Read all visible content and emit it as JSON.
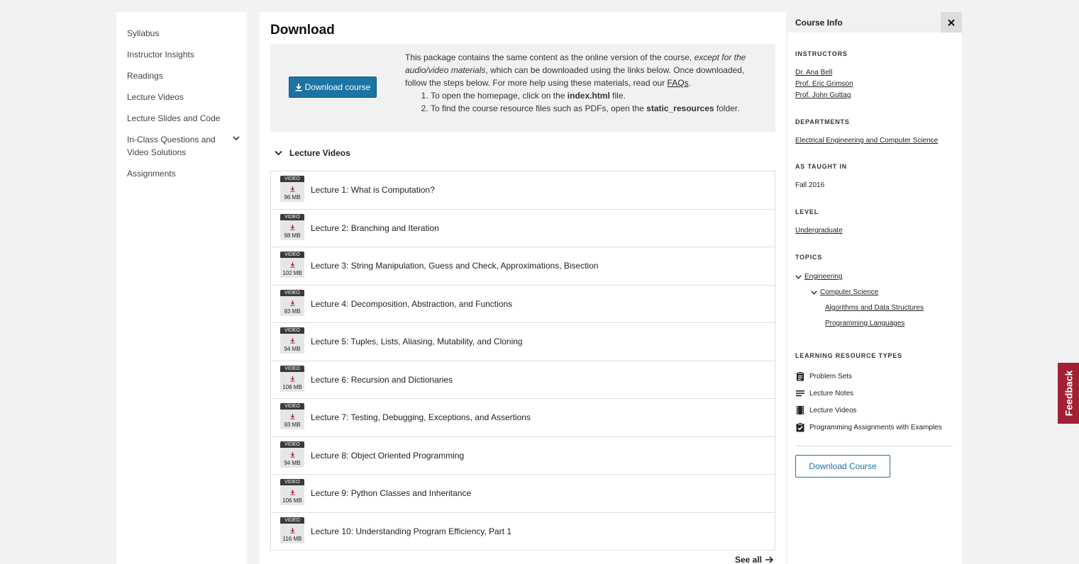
{
  "sidebar": {
    "items": [
      {
        "label": "Syllabus"
      },
      {
        "label": "Instructor Insights"
      },
      {
        "label": "Readings"
      },
      {
        "label": "Lecture Videos"
      },
      {
        "label": "Lecture Slides and Code"
      },
      {
        "label": "In-Class Questions and Video Solutions",
        "expandable": true
      },
      {
        "label": "Assignments"
      }
    ]
  },
  "main": {
    "title": "Download",
    "download_box": {
      "button_label": "Download course",
      "text_intro": "This package contains the same content as the online version of the course, ",
      "text_italic": "except for the audio/video materials",
      "text_middle": ", which can be downloaded using the links below. Once downloaded, follow the steps below. For more help using these materials, read our ",
      "faq_link": "FAQs",
      "text_end": ".",
      "step1_pre": "To open the homepage, click on the ",
      "step1_bold": "index.html",
      "step1_post": " file.",
      "step2_pre": "To find the course resource files such as PDFs, open the ",
      "step2_bold": "static_resources",
      "step2_post": " folder."
    },
    "lecture_videos": {
      "heading": "Lecture Videos",
      "badge_label": "VIDEO",
      "items": [
        {
          "size": "96 MB",
          "title": "Lecture 1: What is Computation?"
        },
        {
          "size": "98 MB",
          "title": "Lecture 2: Branching and Iteration"
        },
        {
          "size": "102 MB",
          "title": "Lecture 3: String Manipulation, Guess and Check, Approximations, Bisection"
        },
        {
          "size": "93 MB",
          "title": "Lecture 4: Decomposition, Abstraction, and Functions"
        },
        {
          "size": "94 MB",
          "title": "Lecture 5: Tuples, Lists, Aliasing, Mutability, and Cloning"
        },
        {
          "size": "108 MB",
          "title": "Lecture 6: Recursion and Dictionaries"
        },
        {
          "size": "93 MB",
          "title": "Lecture 7: Testing, Debugging, Exceptions, and Assertions"
        },
        {
          "size": "94 MB",
          "title": "Lecture 8: Object Oriented Programming"
        },
        {
          "size": "106 MB",
          "title": "Lecture 9: Python Classes and Inheritance"
        },
        {
          "size": "116 MB",
          "title": "Lecture 10: Understanding Program Efficiency, Part 1"
        }
      ],
      "see_all": "See all"
    }
  },
  "course_info": {
    "title": "Course Info",
    "instructors_heading": "INSTRUCTORS",
    "instructors": [
      "Dr. Ana Bell",
      "Prof. Eric Grimson",
      "Prof. John Guttag"
    ],
    "departments_heading": "DEPARTMENTS",
    "department": "Electrical Engineering and Computer Science",
    "taught_heading": "AS TAUGHT IN",
    "taught": "Fall 2016",
    "level_heading": "LEVEL",
    "level": "Undergraduate",
    "topics_heading": "TOPICS",
    "topics": {
      "level1": "Engineering",
      "level2": "Computer Science",
      "level3": [
        "Algorithms and Data Structures",
        "Programming Languages"
      ]
    },
    "lrt_heading": "LEARNING RESOURCE TYPES",
    "resource_types": [
      {
        "icon": "problem-sets-icon",
        "label": "Problem Sets"
      },
      {
        "icon": "lecture-notes-icon",
        "label": "Lecture Notes"
      },
      {
        "icon": "lecture-videos-icon",
        "label": "Lecture Videos"
      },
      {
        "icon": "checked-clipboard-icon",
        "label": "Programming Assignments with Examples"
      }
    ],
    "download_label": "Download Course"
  },
  "feedback_label": "Feedback",
  "colors": {
    "accent": "#1b74a3",
    "download_arrow": "#a31f34",
    "feedback": "#a31f34"
  }
}
